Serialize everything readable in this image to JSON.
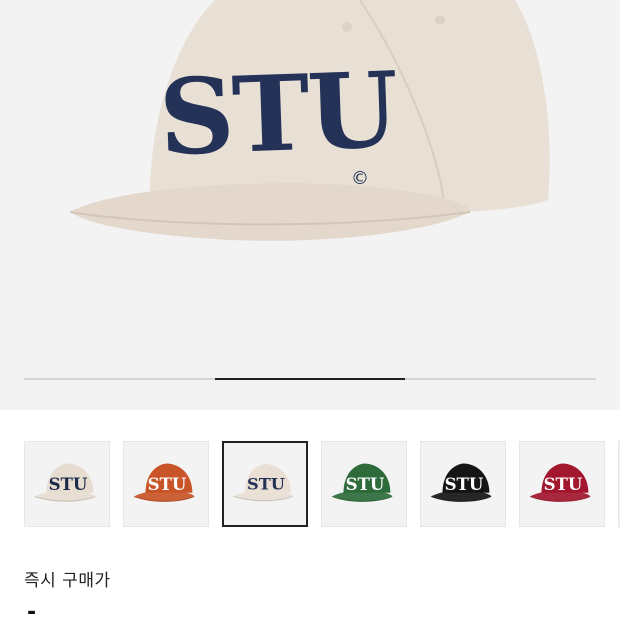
{
  "product": {
    "logo_text": "STU",
    "copyright_mark": "©"
  },
  "gallery": {
    "progress": {
      "index": 2,
      "total": 3
    }
  },
  "thumbnails": [
    {
      "color_name": "khaki",
      "cap_color": "#e6ddd0",
      "text_color": "#1e2a4a",
      "selected": false
    },
    {
      "color_name": "orange",
      "cap_color": "#c95427",
      "text_color": "#ffffff",
      "selected": false
    },
    {
      "color_name": "cream",
      "cap_color": "#e9dfd4",
      "text_color": "#243258",
      "selected": true
    },
    {
      "color_name": "green",
      "cap_color": "#2e6b3a",
      "text_color": "#ffffff",
      "selected": false
    },
    {
      "color_name": "black",
      "cap_color": "#151515",
      "text_color": "#ffffff",
      "selected": false
    },
    {
      "color_name": "burgundy",
      "cap_color": "#a3172e",
      "text_color": "#ffffff",
      "selected": false
    }
  ],
  "price": {
    "label": "즉시 구매가",
    "value": "-"
  }
}
